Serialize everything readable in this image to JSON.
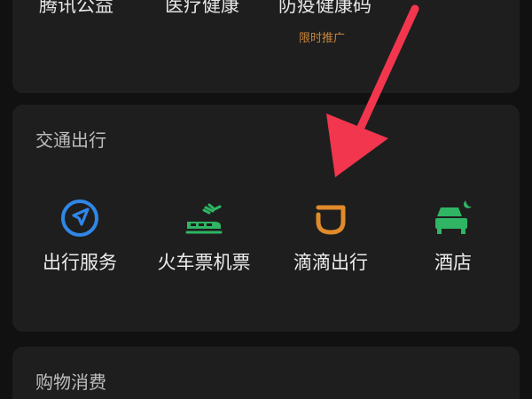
{
  "top_section": {
    "items": [
      {
        "label": "腾讯公益"
      },
      {
        "label": "医疗健康"
      },
      {
        "label": "防疫健康码",
        "sublabel": "限时推广"
      }
    ]
  },
  "transport_section": {
    "title": "交通出行",
    "items": [
      {
        "label": "出行服务",
        "icon": "navigation-icon",
        "color": "#2f87e8"
      },
      {
        "label": "火车票机票",
        "icon": "train-plane-icon",
        "color": "#2fb563"
      },
      {
        "label": "滴滴出行",
        "icon": "didi-icon",
        "color": "#e08a2a"
      },
      {
        "label": "酒店",
        "icon": "hotel-bed-icon",
        "color": "#2fb563"
      }
    ]
  },
  "shopping_section": {
    "title": "购物消费"
  },
  "annotation": {
    "arrow_color": "#f2364e"
  }
}
